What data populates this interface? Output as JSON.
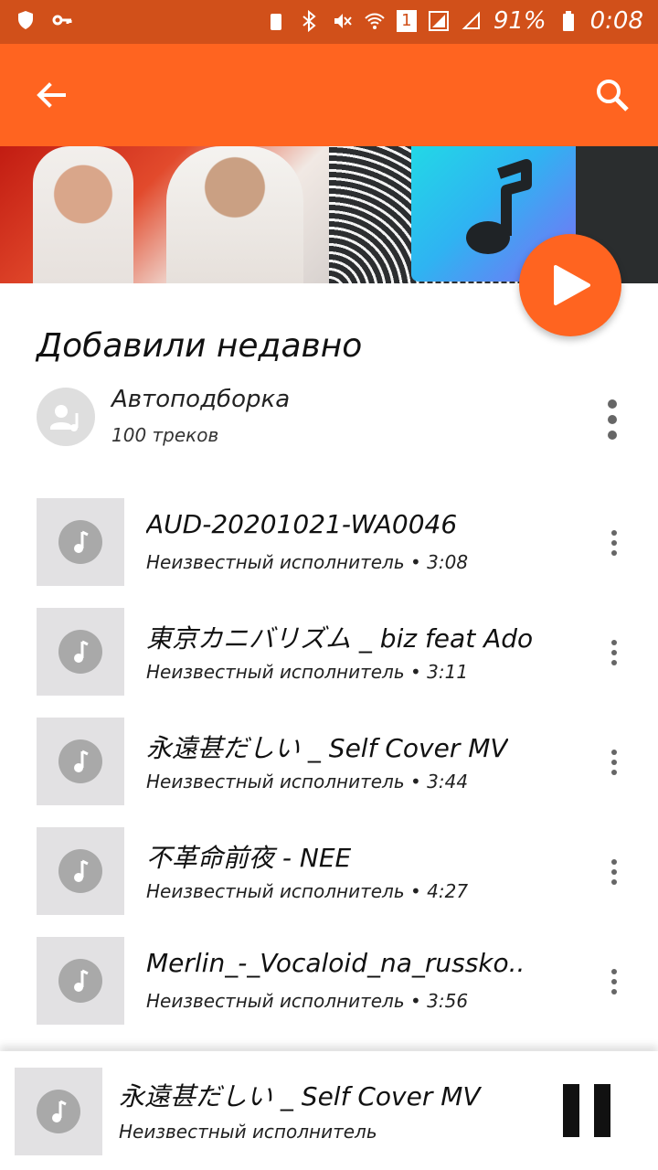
{
  "status_bar": {
    "battery_percent": "91%",
    "time": "0:08",
    "sim_badge": "1"
  },
  "toolbar": {
    "back_icon": "arrow-left-icon",
    "search_icon": "search-icon",
    "color": "#ff6420"
  },
  "playlist": {
    "title": "Добавили недавно",
    "auto_name": "Автоподборка",
    "auto_count": "100 треков"
  },
  "tracks": [
    {
      "title": "AUD-20201021-WA0046",
      "meta": "Неизвестный исполнитель • 3:08"
    },
    {
      "title": "東京カニバリズム _ biz feat Ado",
      "meta": "Неизвестный исполнитель • 3:11"
    },
    {
      "title": "永遠甚だしい _ Self Cover  MV",
      "meta": "Неизвестный исполнитель • 3:44"
    },
    {
      "title": "不革命前夜 - NEE",
      "meta": "Неизвестный исполнитель • 4:27"
    },
    {
      "title": "Merlin_-_Vocaloid_na_russko..",
      "meta": "Неизвестный исполнитель • 3:56"
    }
  ],
  "now_playing": {
    "title": "永遠甚だしい _ Self Cover  MV",
    "artist": "Неизвестный исполнитель"
  }
}
